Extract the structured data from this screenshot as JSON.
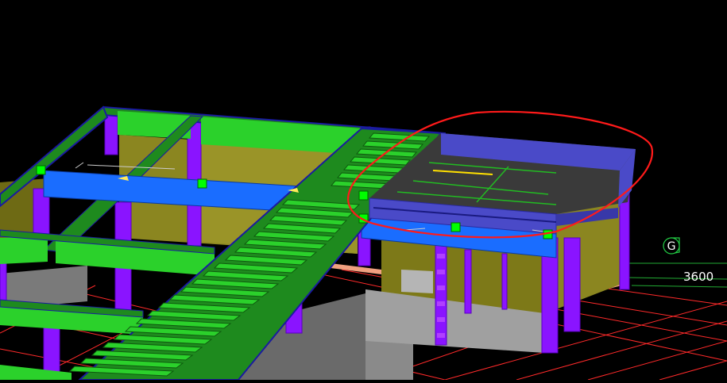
{
  "viewport": {
    "axis_grid": {
      "bubble_label": "G",
      "dimension_label": "3600"
    },
    "colors": {
      "background": "#000000",
      "beam_green": "#2bd12b",
      "beam_dark_green": "#1e8a1e",
      "beam_blue": "#1a6dff",
      "column_purple": "#8a14ff",
      "wall_olive": "#8b8620",
      "slab_dark": "#3a3a3a",
      "roof_blue": "#4a4ac8",
      "grid_red": "#ff2a2a",
      "grid_green": "#22aa33",
      "markup_red": "#ff1a1a",
      "grip_green": "#00ff00",
      "wall_gray": "#9a9a9a",
      "foundation_salmon": "#f0a080"
    }
  }
}
